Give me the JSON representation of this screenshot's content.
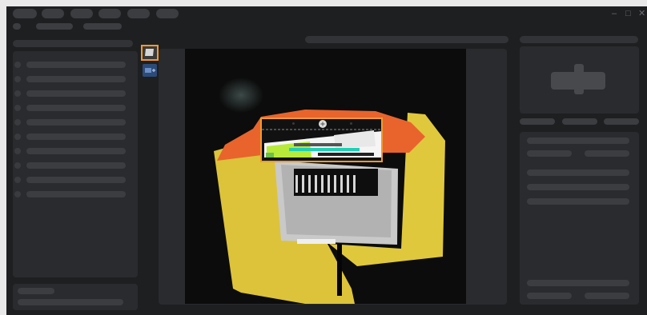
{
  "window": {
    "controls": {
      "minimize": "–",
      "maximize": "□",
      "close": "✕"
    }
  },
  "accent_color": "#f29a2e",
  "toolbar": {
    "icons": [
      "select-roi-icon",
      "add-roi-icon"
    ],
    "active_icon": "select-roi-icon"
  },
  "viewer": {
    "roi_icon": "center-handle-icon"
  }
}
